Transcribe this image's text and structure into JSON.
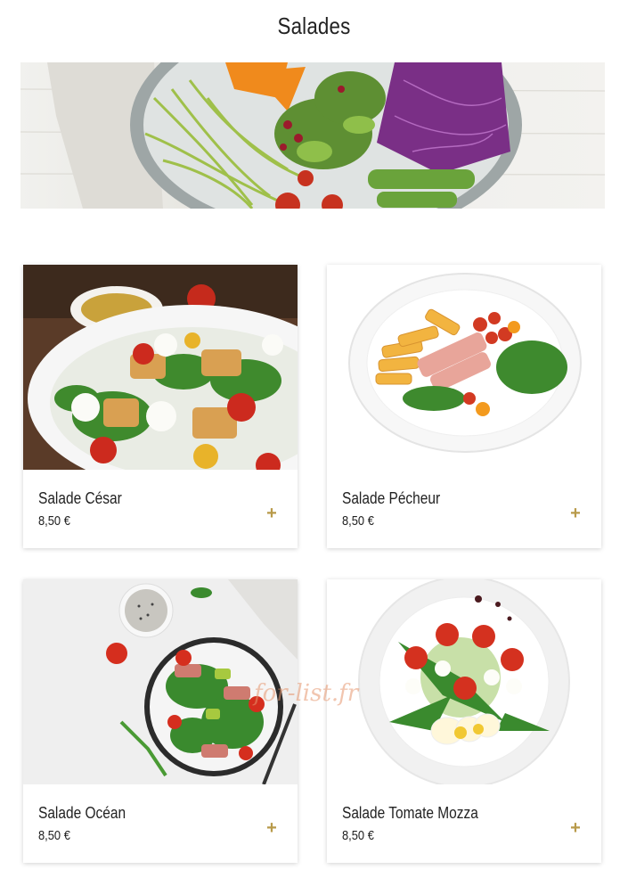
{
  "page": {
    "title": "Salades"
  },
  "hero": {
    "image": "salad-bowl-banner"
  },
  "products": [
    {
      "name": "Salade César",
      "price": "8,50 €",
      "image": "caesar-salad-photo",
      "add_icon": "plus-icon"
    },
    {
      "name": "Salade Pécheur",
      "price": "8,50 €",
      "image": "fisherman-salad-photo",
      "add_icon": "plus-icon"
    },
    {
      "name": "Salade Océan",
      "price": "8,50 €",
      "image": "ocean-salad-photo",
      "add_icon": "plus-icon"
    },
    {
      "name": "Salade Tomate Mozza",
      "price": "8,50 €",
      "image": "tomato-mozza-salad-photo",
      "add_icon": "plus-icon"
    }
  ],
  "watermark": "for-list.fr",
  "colors": {
    "accent": "#b89a4a",
    "text": "#222222",
    "background": "#ffffff"
  }
}
